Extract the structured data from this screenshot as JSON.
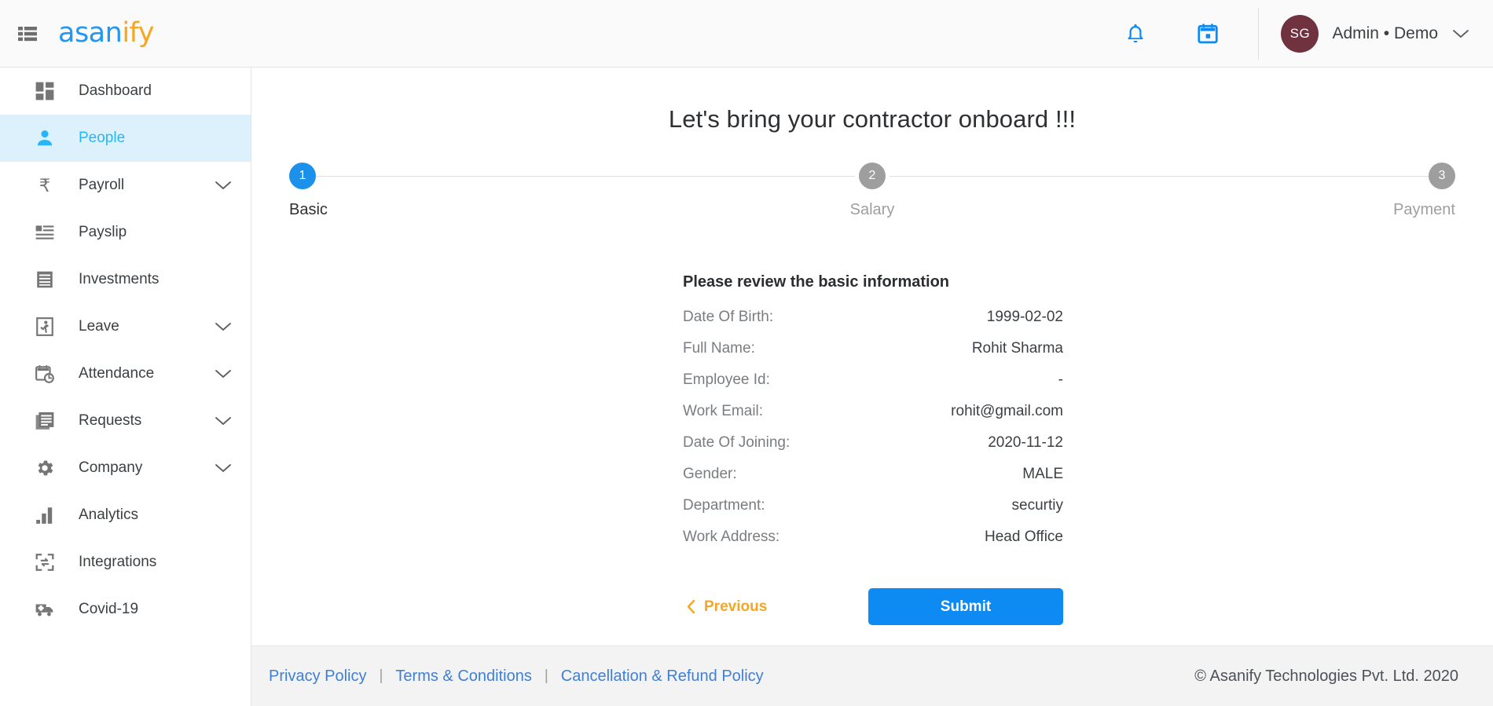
{
  "header": {
    "menu_icon": "list-menu-icon",
    "brand_primary": "asan",
    "brand_accent": "ify",
    "notification_icon": "bell-icon",
    "calendar_icon": "calendar-icon",
    "avatar_initials": "SG",
    "profile_name": "Admin • Demo",
    "profile_caret_icon": "chevron-down-icon",
    "background": "#fafafa",
    "brand_blue": "#2196f3",
    "brand_orange": "#f5a623",
    "avatar_color": "#70323e",
    "icon_blue": "#0d8bf2"
  },
  "sidebar": {
    "items": [
      {
        "label": "Dashboard",
        "icon": "dashboard-grid-icon",
        "active": false,
        "expandable": false
      },
      {
        "label": "People",
        "icon": "person-icon",
        "active": true,
        "expandable": false
      },
      {
        "label": "Payroll",
        "icon": "rupee-icon",
        "active": false,
        "expandable": true
      },
      {
        "label": "Payslip",
        "icon": "payslip-document-icon",
        "active": false,
        "expandable": false
      },
      {
        "label": "Investments",
        "icon": "receipt-icon",
        "active": false,
        "expandable": false
      },
      {
        "label": "Leave",
        "icon": "exit-door-icon",
        "active": false,
        "expandable": true
      },
      {
        "label": "Attendance",
        "icon": "calendar-clock-icon",
        "active": false,
        "expandable": true
      },
      {
        "label": "Requests",
        "icon": "documents-stack-icon",
        "active": false,
        "expandable": true
      },
      {
        "label": "Company",
        "icon": "gear-icon",
        "active": false,
        "expandable": true
      },
      {
        "label": "Analytics",
        "icon": "bar-chart-icon",
        "active": false,
        "expandable": false
      },
      {
        "label": "Integrations",
        "icon": "integrations-icon",
        "active": false,
        "expandable": false
      },
      {
        "label": "Covid-19",
        "icon": "ambulance-icon",
        "active": false,
        "expandable": false
      }
    ],
    "active_bg": "#ddf1fc",
    "active_color": "#29b6f6"
  },
  "main": {
    "page_title": "Let's bring your contractor onboard !!!",
    "stepper": {
      "steps": [
        {
          "number": "1",
          "label": "Basic",
          "state": "active"
        },
        {
          "number": "2",
          "label": "Salary",
          "state": "inactive"
        },
        {
          "number": "3",
          "label": "Payment",
          "state": "inactive"
        }
      ],
      "active_color": "#1b91ec",
      "inactive_color": "#9e9e9e"
    },
    "review": {
      "heading": "Please review the basic information",
      "fields": [
        {
          "label": "Date Of Birth:",
          "value": "1999-02-02"
        },
        {
          "label": "Full Name:",
          "value": "Rohit Sharma"
        },
        {
          "label": "Employee Id:",
          "value": "-"
        },
        {
          "label": "Work Email:",
          "value": "rohit@gmail.com"
        },
        {
          "label": "Date Of Joining:",
          "value": "2020-11-12"
        },
        {
          "label": "Gender:",
          "value": "MALE"
        },
        {
          "label": "Department:",
          "value": "securtiy"
        },
        {
          "label": "Work Address:",
          "value": "Head Office"
        }
      ]
    },
    "actions": {
      "previous_label": "Previous",
      "previous_icon": "chevron-left-icon",
      "previous_color": "#f5a623",
      "submit_label": "Submit",
      "submit_color": "#0d8bf2"
    }
  },
  "footer": {
    "links": [
      {
        "label": "Privacy Policy"
      },
      {
        "label": "Terms & Conditions"
      },
      {
        "label": "Cancellation & Refund Policy"
      }
    ],
    "separator": "|",
    "copyright": "© Asanify Technologies Pvt. Ltd. 2020",
    "link_color": "#3f7fd6",
    "background": "#f3f3f3"
  }
}
